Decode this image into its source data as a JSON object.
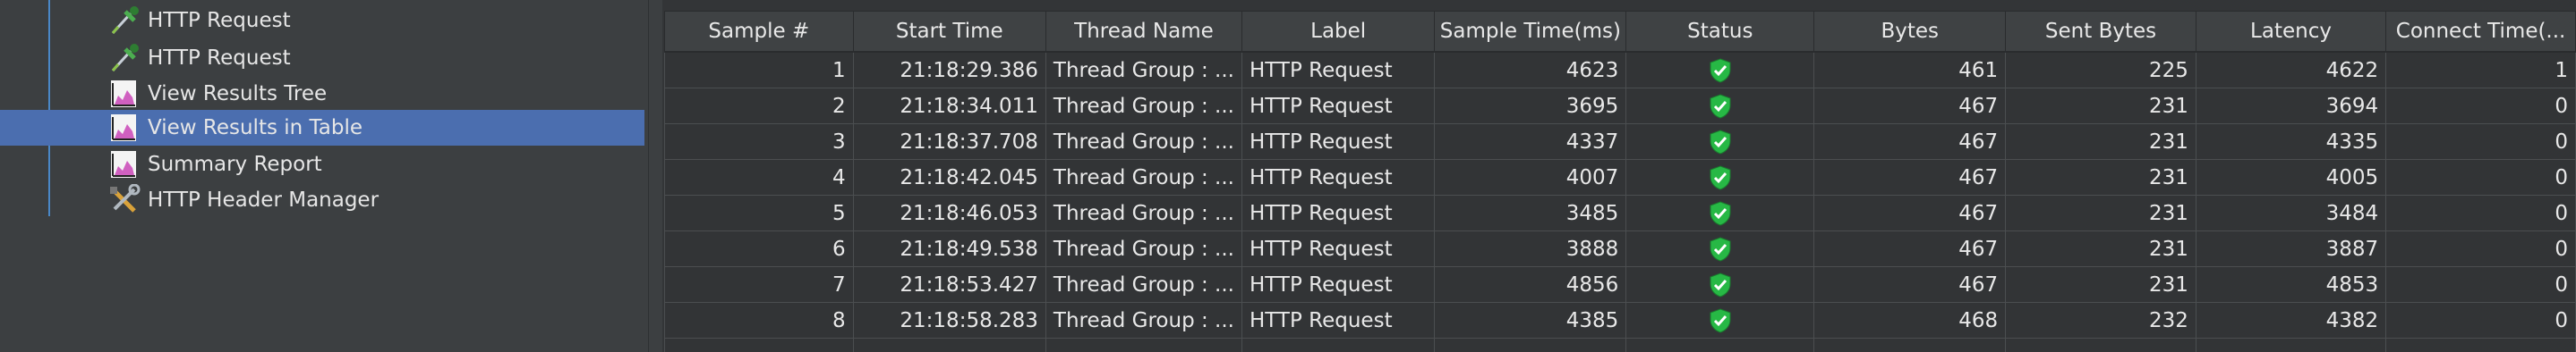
{
  "tree": {
    "items": [
      {
        "label": "HTTP Request",
        "icon": "pipette-icon",
        "selected": false
      },
      {
        "label": "HTTP Request",
        "icon": "pipette-icon",
        "selected": false
      },
      {
        "label": "View Results Tree",
        "icon": "graph-icon",
        "selected": false
      },
      {
        "label": "View Results in Table",
        "icon": "graph-icon",
        "selected": true
      },
      {
        "label": "Summary Report",
        "icon": "graph-icon",
        "selected": false
      },
      {
        "label": "HTTP Header Manager",
        "icon": "tools-icon",
        "selected": false
      }
    ]
  },
  "results_table": {
    "columns": [
      "Sample #",
      "Start Time",
      "Thread Name",
      "Label",
      "Sample Time(ms)",
      "Status",
      "Bytes",
      "Sent Bytes",
      "Latency",
      "Connect Time(..."
    ],
    "rows": [
      {
        "sample": "1",
        "start": "21:18:29.386",
        "thread": "Thread Group : ...",
        "label": "HTTP Request",
        "sample_time": "4623",
        "status": "success",
        "bytes": "461",
        "sent_bytes": "225",
        "latency": "4622",
        "connect": "1"
      },
      {
        "sample": "2",
        "start": "21:18:34.011",
        "thread": "Thread Group : ...",
        "label": "HTTP Request",
        "sample_time": "3695",
        "status": "success",
        "bytes": "467",
        "sent_bytes": "231",
        "latency": "3694",
        "connect": "0"
      },
      {
        "sample": "3",
        "start": "21:18:37.708",
        "thread": "Thread Group : ...",
        "label": "HTTP Request",
        "sample_time": "4337",
        "status": "success",
        "bytes": "467",
        "sent_bytes": "231",
        "latency": "4335",
        "connect": "0"
      },
      {
        "sample": "4",
        "start": "21:18:42.045",
        "thread": "Thread Group : ...",
        "label": "HTTP Request",
        "sample_time": "4007",
        "status": "success",
        "bytes": "467",
        "sent_bytes": "231",
        "latency": "4005",
        "connect": "0"
      },
      {
        "sample": "5",
        "start": "21:18:46.053",
        "thread": "Thread Group : ...",
        "label": "HTTP Request",
        "sample_time": "3485",
        "status": "success",
        "bytes": "467",
        "sent_bytes": "231",
        "latency": "3484",
        "connect": "0"
      },
      {
        "sample": "6",
        "start": "21:18:49.538",
        "thread": "Thread Group : ...",
        "label": "HTTP Request",
        "sample_time": "3888",
        "status": "success",
        "bytes": "467",
        "sent_bytes": "231",
        "latency": "3887",
        "connect": "0"
      },
      {
        "sample": "7",
        "start": "21:18:53.427",
        "thread": "Thread Group : ...",
        "label": "HTTP Request",
        "sample_time": "4856",
        "status": "success",
        "bytes": "467",
        "sent_bytes": "231",
        "latency": "4853",
        "connect": "0"
      },
      {
        "sample": "8",
        "start": "21:18:58.283",
        "thread": "Thread Group : ...",
        "label": "HTTP Request",
        "sample_time": "4385",
        "status": "success",
        "bytes": "468",
        "sent_bytes": "232",
        "latency": "4382",
        "connect": "0"
      }
    ]
  },
  "colors": {
    "selection": "#4b6eaf",
    "status_success": "#27b845"
  }
}
